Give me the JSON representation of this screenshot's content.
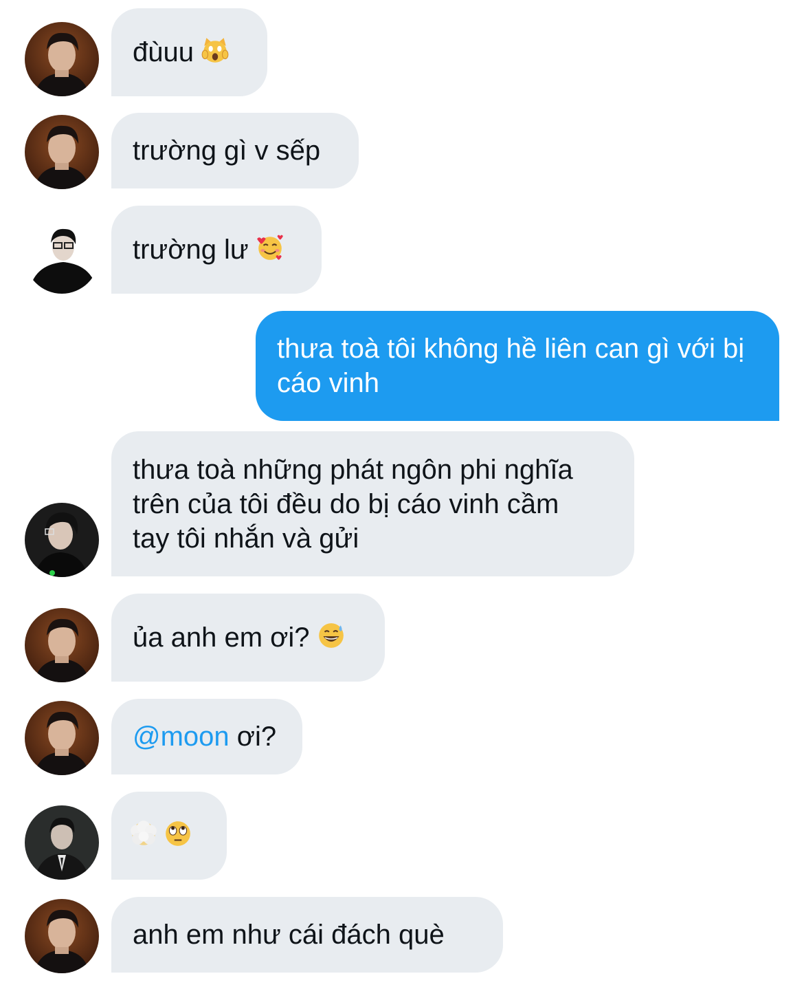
{
  "messages": [
    {
      "sender": "avatar-a",
      "text": "đùuu",
      "emoji": "screaming-cat-emoji"
    },
    {
      "sender": "avatar-a",
      "text": "trường gì v sếp"
    },
    {
      "sender": "avatar-b",
      "text": "trường lư",
      "emoji": "smiling-face-with-hearts-emoji"
    },
    {
      "sender": "me",
      "text": "thưa toà tôi không hề liên can gì với bị cáo vinh"
    },
    {
      "sender": "avatar-c",
      "text": "thưa toà những phát ngôn phi nghĩa trên của tôi đều do bị cáo vinh cầm tay tôi nhắn và gửi"
    },
    {
      "sender": "avatar-a",
      "text": "ủa anh em ơi?",
      "emoji": "grinning-sweat-emoji"
    },
    {
      "sender": "avatar-a",
      "mention": "@moon",
      "text": " ơi?"
    },
    {
      "sender": "avatar-d",
      "emoji": [
        "face-in-clouds-emoji",
        "rolling-eyes-emoji"
      ]
    },
    {
      "sender": "avatar-a",
      "text": "anh em như cái đách què"
    }
  ],
  "colors": {
    "incoming_bubble": "#e8ecf0",
    "outgoing_bubble": "#1d9bf0",
    "mention": "#1d9bf0"
  }
}
